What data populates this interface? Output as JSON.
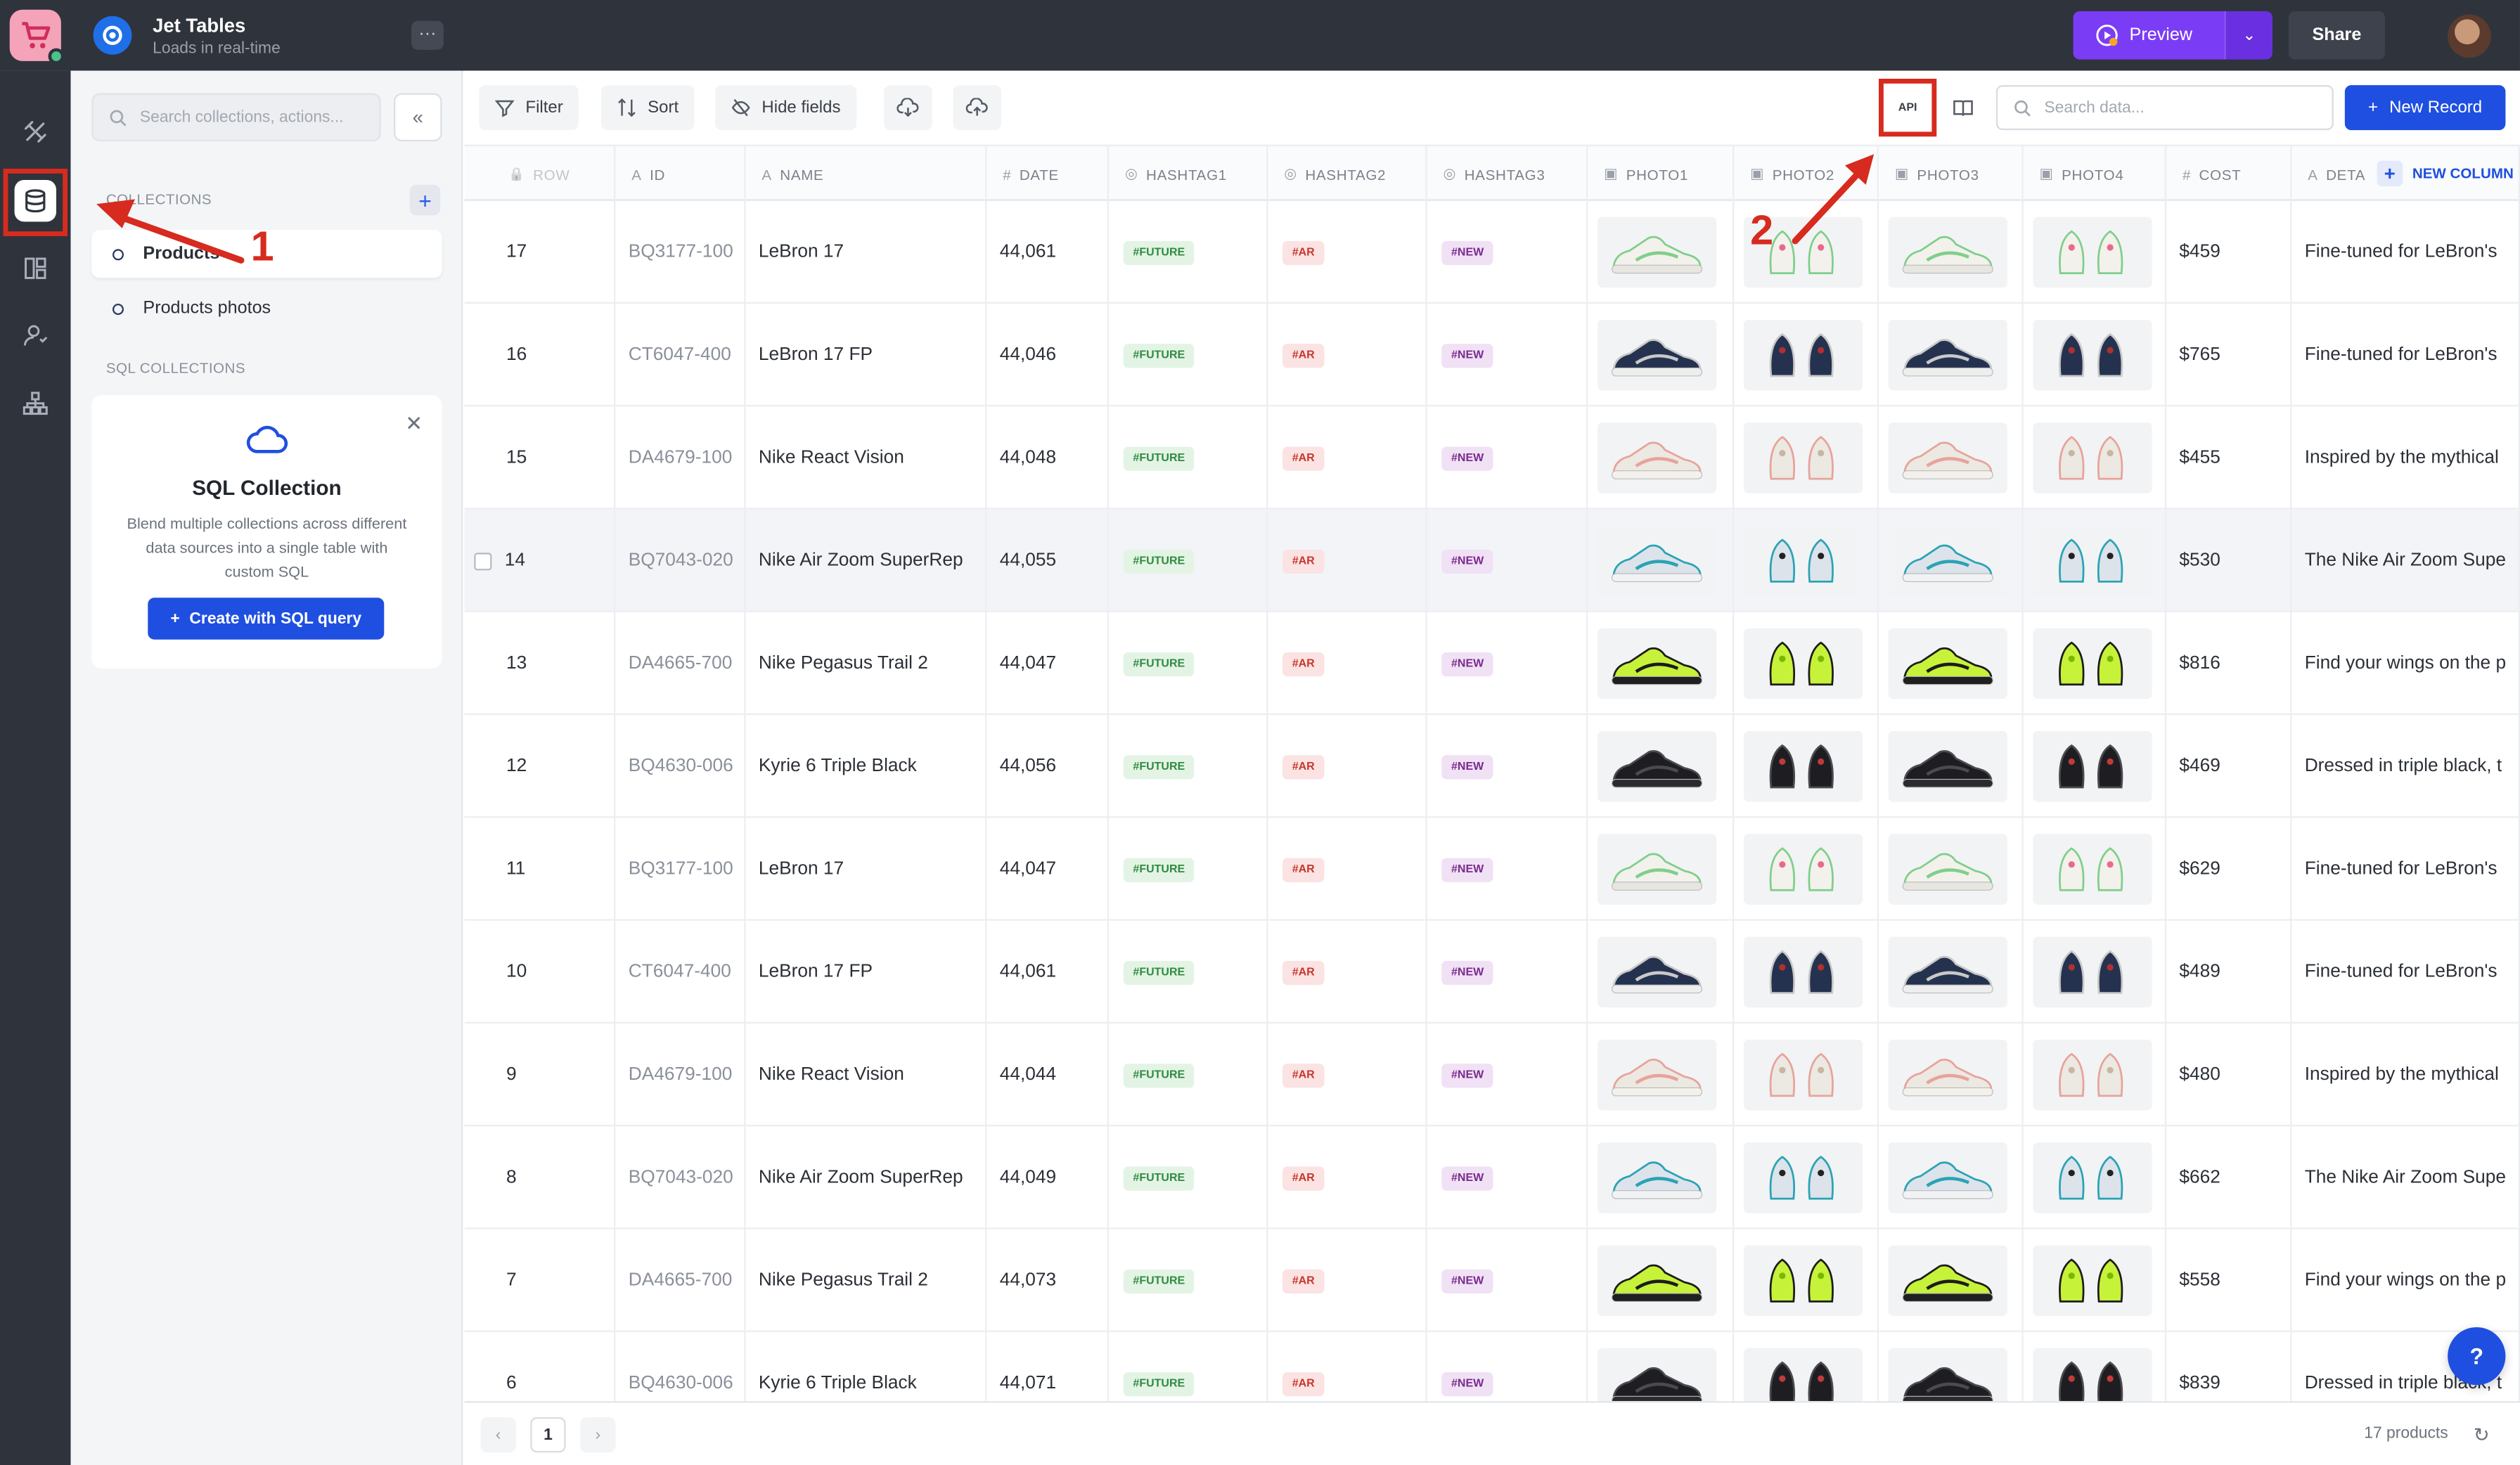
{
  "header": {
    "project_title": "Jet Tables",
    "project_subtitle": "Loads in real-time",
    "more_label": "···",
    "preview_label": "Preview",
    "share_label": "Share"
  },
  "sidebar": {
    "search_placeholder": "Search collections, actions...",
    "collections_label": "COLLECTIONS",
    "collections": [
      {
        "label": "Products",
        "selected": true
      },
      {
        "label": "Products photos",
        "selected": false
      }
    ],
    "sql_collections_label": "SQL COLLECTIONS",
    "sql_card": {
      "title": "SQL Collection",
      "description": "Blend multiple collections across different data sources into a single table with custom SQL",
      "button_label": "Create with SQL query"
    }
  },
  "toolbar": {
    "filter_label": "Filter",
    "sort_label": "Sort",
    "hide_fields_label": "Hide fields",
    "api_label": "API",
    "search_placeholder": "Search data...",
    "new_record_label": "New Record"
  },
  "table": {
    "columns": [
      {
        "label": "ROW",
        "icon": "lock-icon"
      },
      {
        "label": "ID",
        "icon": "text-icon"
      },
      {
        "label": "NAME",
        "icon": "text-icon"
      },
      {
        "label": "DATE",
        "icon": "number-icon"
      },
      {
        "label": "HASHTAG1",
        "icon": "select-icon"
      },
      {
        "label": "HASHTAG2",
        "icon": "select-icon"
      },
      {
        "label": "HASHTAG3",
        "icon": "select-icon"
      },
      {
        "label": "PHOTO1",
        "icon": "image-icon"
      },
      {
        "label": "PHOTO2",
        "icon": "image-icon"
      },
      {
        "label": "PHOTO3",
        "icon": "image-icon"
      },
      {
        "label": "PHOTO4",
        "icon": "image-icon"
      },
      {
        "label": "COST",
        "icon": "number-icon"
      },
      {
        "label": "DETA",
        "icon": "text-icon"
      }
    ],
    "new_column_label": "NEW COLUMN",
    "rows": [
      {
        "row": "17",
        "id": "BQ3177-100",
        "name": "LeBron 17",
        "date": "44,061",
        "h1": "#FUTURE",
        "h2": "#AR",
        "h3": "#NEW",
        "cost": "$459",
        "details": "Fine-tuned for LeBron's",
        "shoe": "white"
      },
      {
        "row": "16",
        "id": "CT6047-400",
        "name": "LeBron 17 FP",
        "date": "44,046",
        "h1": "#FUTURE",
        "h2": "#AR",
        "h3": "#NEW",
        "cost": "$765",
        "details": "Fine-tuned for LeBron's",
        "shoe": "navy"
      },
      {
        "row": "15",
        "id": "DA4679-100",
        "name": "Nike React Vision",
        "date": "44,048",
        "h1": "#FUTURE",
        "h2": "#AR",
        "h3": "#NEW",
        "cost": "$455",
        "details": "Inspired by the mythical",
        "shoe": "cream"
      },
      {
        "row": "14",
        "id": "BQ7043-020",
        "name": "Nike Air Zoom SuperRep",
        "date": "44,055",
        "h1": "#FUTURE",
        "h2": "#AR",
        "h3": "#NEW",
        "cost": "$530",
        "details": "The Nike Air Zoom Supe",
        "shoe": "grey"
      },
      {
        "row": "13",
        "id": "DA4665-700",
        "name": "Nike Pegasus Trail 2",
        "date": "44,047",
        "h1": "#FUTURE",
        "h2": "#AR",
        "h3": "#NEW",
        "cost": "$816",
        "details": "Find your wings on the p",
        "shoe": "volt"
      },
      {
        "row": "12",
        "id": "BQ4630-006",
        "name": "Kyrie 6 Triple Black",
        "date": "44,056",
        "h1": "#FUTURE",
        "h2": "#AR",
        "h3": "#NEW",
        "cost": "$469",
        "details": "Dressed in triple black, t",
        "shoe": "black"
      },
      {
        "row": "11",
        "id": "BQ3177-100",
        "name": "LeBron 17",
        "date": "44,047",
        "h1": "#FUTURE",
        "h2": "#AR",
        "h3": "#NEW",
        "cost": "$629",
        "details": "Fine-tuned for LeBron's",
        "shoe": "white"
      },
      {
        "row": "10",
        "id": "CT6047-400",
        "name": "LeBron 17 FP",
        "date": "44,061",
        "h1": "#FUTURE",
        "h2": "#AR",
        "h3": "#NEW",
        "cost": "$489",
        "details": "Fine-tuned for LeBron's",
        "shoe": "navy"
      },
      {
        "row": "9",
        "id": "DA4679-100",
        "name": "Nike React Vision",
        "date": "44,044",
        "h1": "#FUTURE",
        "h2": "#AR",
        "h3": "#NEW",
        "cost": "$480",
        "details": "Inspired by the mythical",
        "shoe": "cream"
      },
      {
        "row": "8",
        "id": "BQ7043-020",
        "name": "Nike Air Zoom SuperRep",
        "date": "44,049",
        "h1": "#FUTURE",
        "h2": "#AR",
        "h3": "#NEW",
        "cost": "$662",
        "details": "The Nike Air Zoom Supe",
        "shoe": "grey"
      },
      {
        "row": "7",
        "id": "DA4665-700",
        "name": "Nike Pegasus Trail 2",
        "date": "44,073",
        "h1": "#FUTURE",
        "h2": "#AR",
        "h3": "#NEW",
        "cost": "$558",
        "details": "Find your wings on the p",
        "shoe": "volt"
      },
      {
        "row": "6",
        "id": "BQ4630-006",
        "name": "Kyrie 6 Triple Black",
        "date": "44,071",
        "h1": "#FUTURE",
        "h2": "#AR",
        "h3": "#NEW",
        "cost": "$839",
        "details": "Dressed in triple black, t",
        "shoe": "black"
      }
    ]
  },
  "footer": {
    "prev_label": "‹",
    "page": "1",
    "next_label": "›",
    "count_label": "17 products"
  },
  "annotations": {
    "step1": "1",
    "step2": "2",
    "color": "#d62b1e"
  },
  "colors": {
    "brand_blue": "#1f4fe0",
    "preview_purple": "#7b3cf6",
    "topbar": "#2f333c"
  }
}
